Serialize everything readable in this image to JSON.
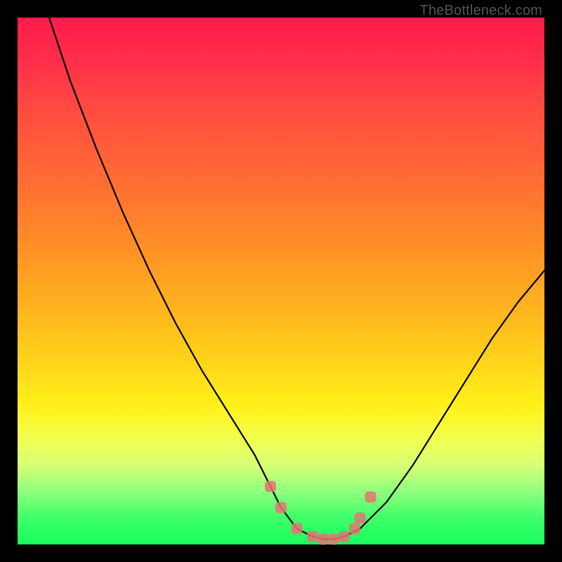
{
  "watermark": "TheBottleneck.com",
  "colors": {
    "frame": "#000000",
    "curve": "#000000",
    "marker": "#e57373",
    "gradient_top": "#ff1a4b",
    "gradient_bottom": "#18ff5c"
  },
  "chart_data": {
    "type": "line",
    "title": "",
    "xlabel": "",
    "ylabel": "",
    "xlim": [
      0,
      100
    ],
    "ylim": [
      0,
      100
    ],
    "series": [
      {
        "name": "bottleneck-curve",
        "x": [
          6,
          10,
          15,
          20,
          25,
          30,
          35,
          40,
          45,
          48,
          50,
          53,
          56,
          58,
          60,
          62,
          65,
          70,
          75,
          80,
          85,
          90,
          95,
          100
        ],
        "y": [
          100,
          88,
          75,
          63,
          52,
          42,
          33,
          25,
          17,
          11,
          7,
          3,
          1.5,
          1,
          1,
          1.5,
          3,
          8,
          15,
          23,
          31,
          39,
          46,
          52
        ]
      }
    ],
    "markers": {
      "name": "highlight-points",
      "x": [
        48,
        50,
        53,
        56,
        58,
        60,
        62,
        64,
        65,
        67
      ],
      "y": [
        11,
        7,
        3,
        1.5,
        1,
        1,
        1.5,
        3,
        5,
        9
      ]
    }
  }
}
